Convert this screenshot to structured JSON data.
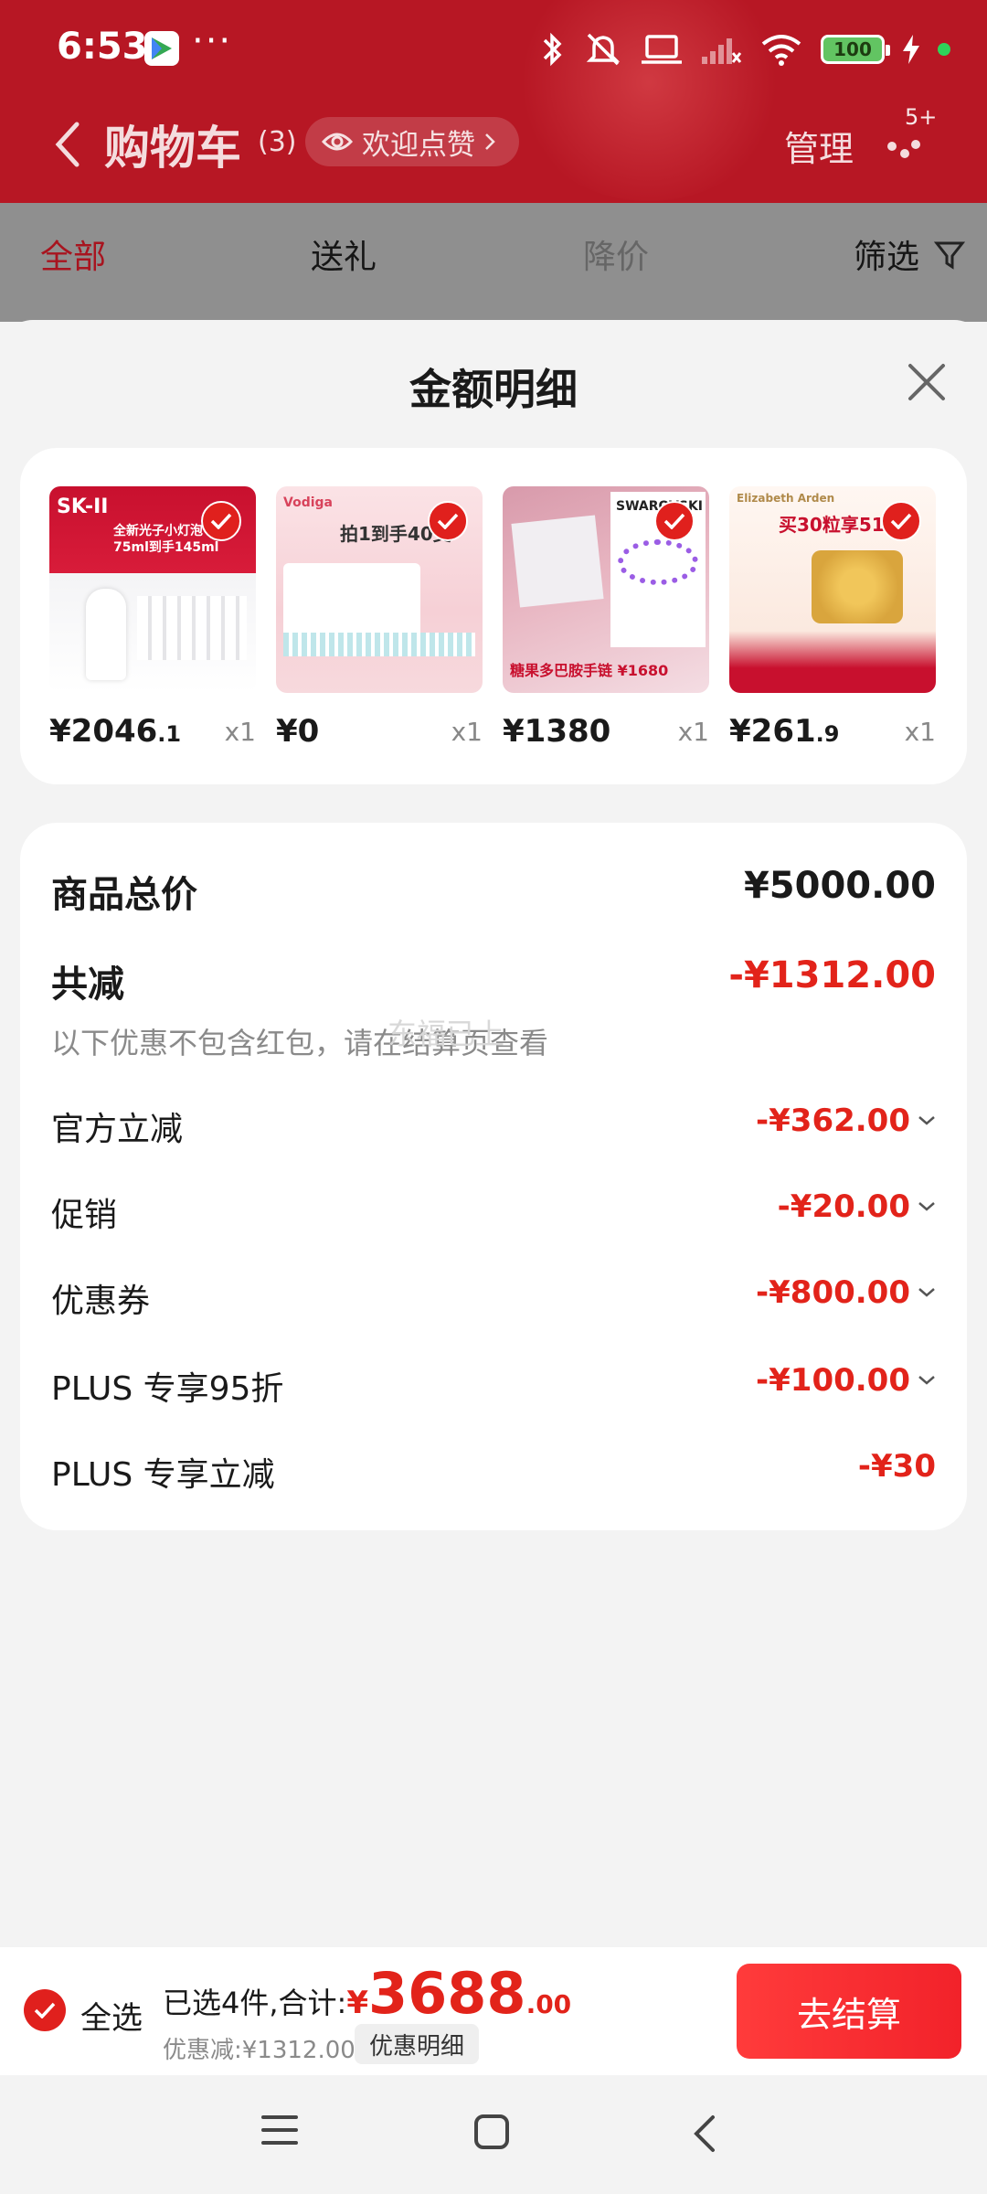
{
  "status_bar": {
    "time": "6:53",
    "more": "···",
    "battery": "100"
  },
  "header": {
    "title": "购物车",
    "count": "(3)",
    "welcome": "欢迎点赞",
    "manage": "管理",
    "badge": "5+"
  },
  "tabs": [
    {
      "label": "全部",
      "active": true
    },
    {
      "label": "送礼"
    },
    {
      "label": "降价"
    },
    {
      "label": "筛选"
    }
  ],
  "sheet": {
    "title": "金额明细"
  },
  "products": [
    {
      "price_int": "¥2046",
      "price_dec": ".1",
      "qty": "x1",
      "thumb_text": "全新光子小灯泡 买75ml到手145ml",
      "brand": "SK-II"
    },
    {
      "price_int": "¥0",
      "price_dec": "",
      "qty": "x1",
      "thumb_text": "拍1到手40支",
      "brand": "Vodiga"
    },
    {
      "price_int": "¥1380",
      "price_dec": "",
      "qty": "x1",
      "thumb_text": "糖果多巴胺手链 ¥1680",
      "brand": "SWAROVSKI"
    },
    {
      "price_int": "¥261",
      "price_dec": ".9",
      "qty": "x1",
      "thumb_text": "买30粒享51粒",
      "brand": "Elizabeth Arden"
    }
  ],
  "detail": {
    "total_label": "商品总价",
    "total_value": "¥5000.00",
    "reduce_label": "共减",
    "reduce_value": "-¥1312.00",
    "note": "以下优惠不包含红包，请在结算页查看",
    "watermark": "东福已上",
    "items": [
      {
        "label": "官方立减",
        "value": "-¥362.00",
        "expand": true
      },
      {
        "label": "促销",
        "value": "-¥20.00",
        "expand": true
      },
      {
        "label": "优惠券",
        "value": "-¥800.00",
        "expand": true
      },
      {
        "label": "PLUS 专享95折",
        "value": "-¥100.00",
        "expand": true
      },
      {
        "label": "PLUS 专享立减",
        "value": "-¥30",
        "expand": false
      }
    ]
  },
  "bottom": {
    "select_all": "全选",
    "selected": "已选4件,合计:",
    "currency": "¥",
    "total_int": "3688",
    "total_dec": ".00",
    "discount": "优惠减:¥1312.00",
    "discount_btn": "优惠明细",
    "checkout": "去结算"
  },
  "colors": {
    "brand_red": "#b71724",
    "accent": "#e2231a",
    "checkout": "#f2222a"
  }
}
